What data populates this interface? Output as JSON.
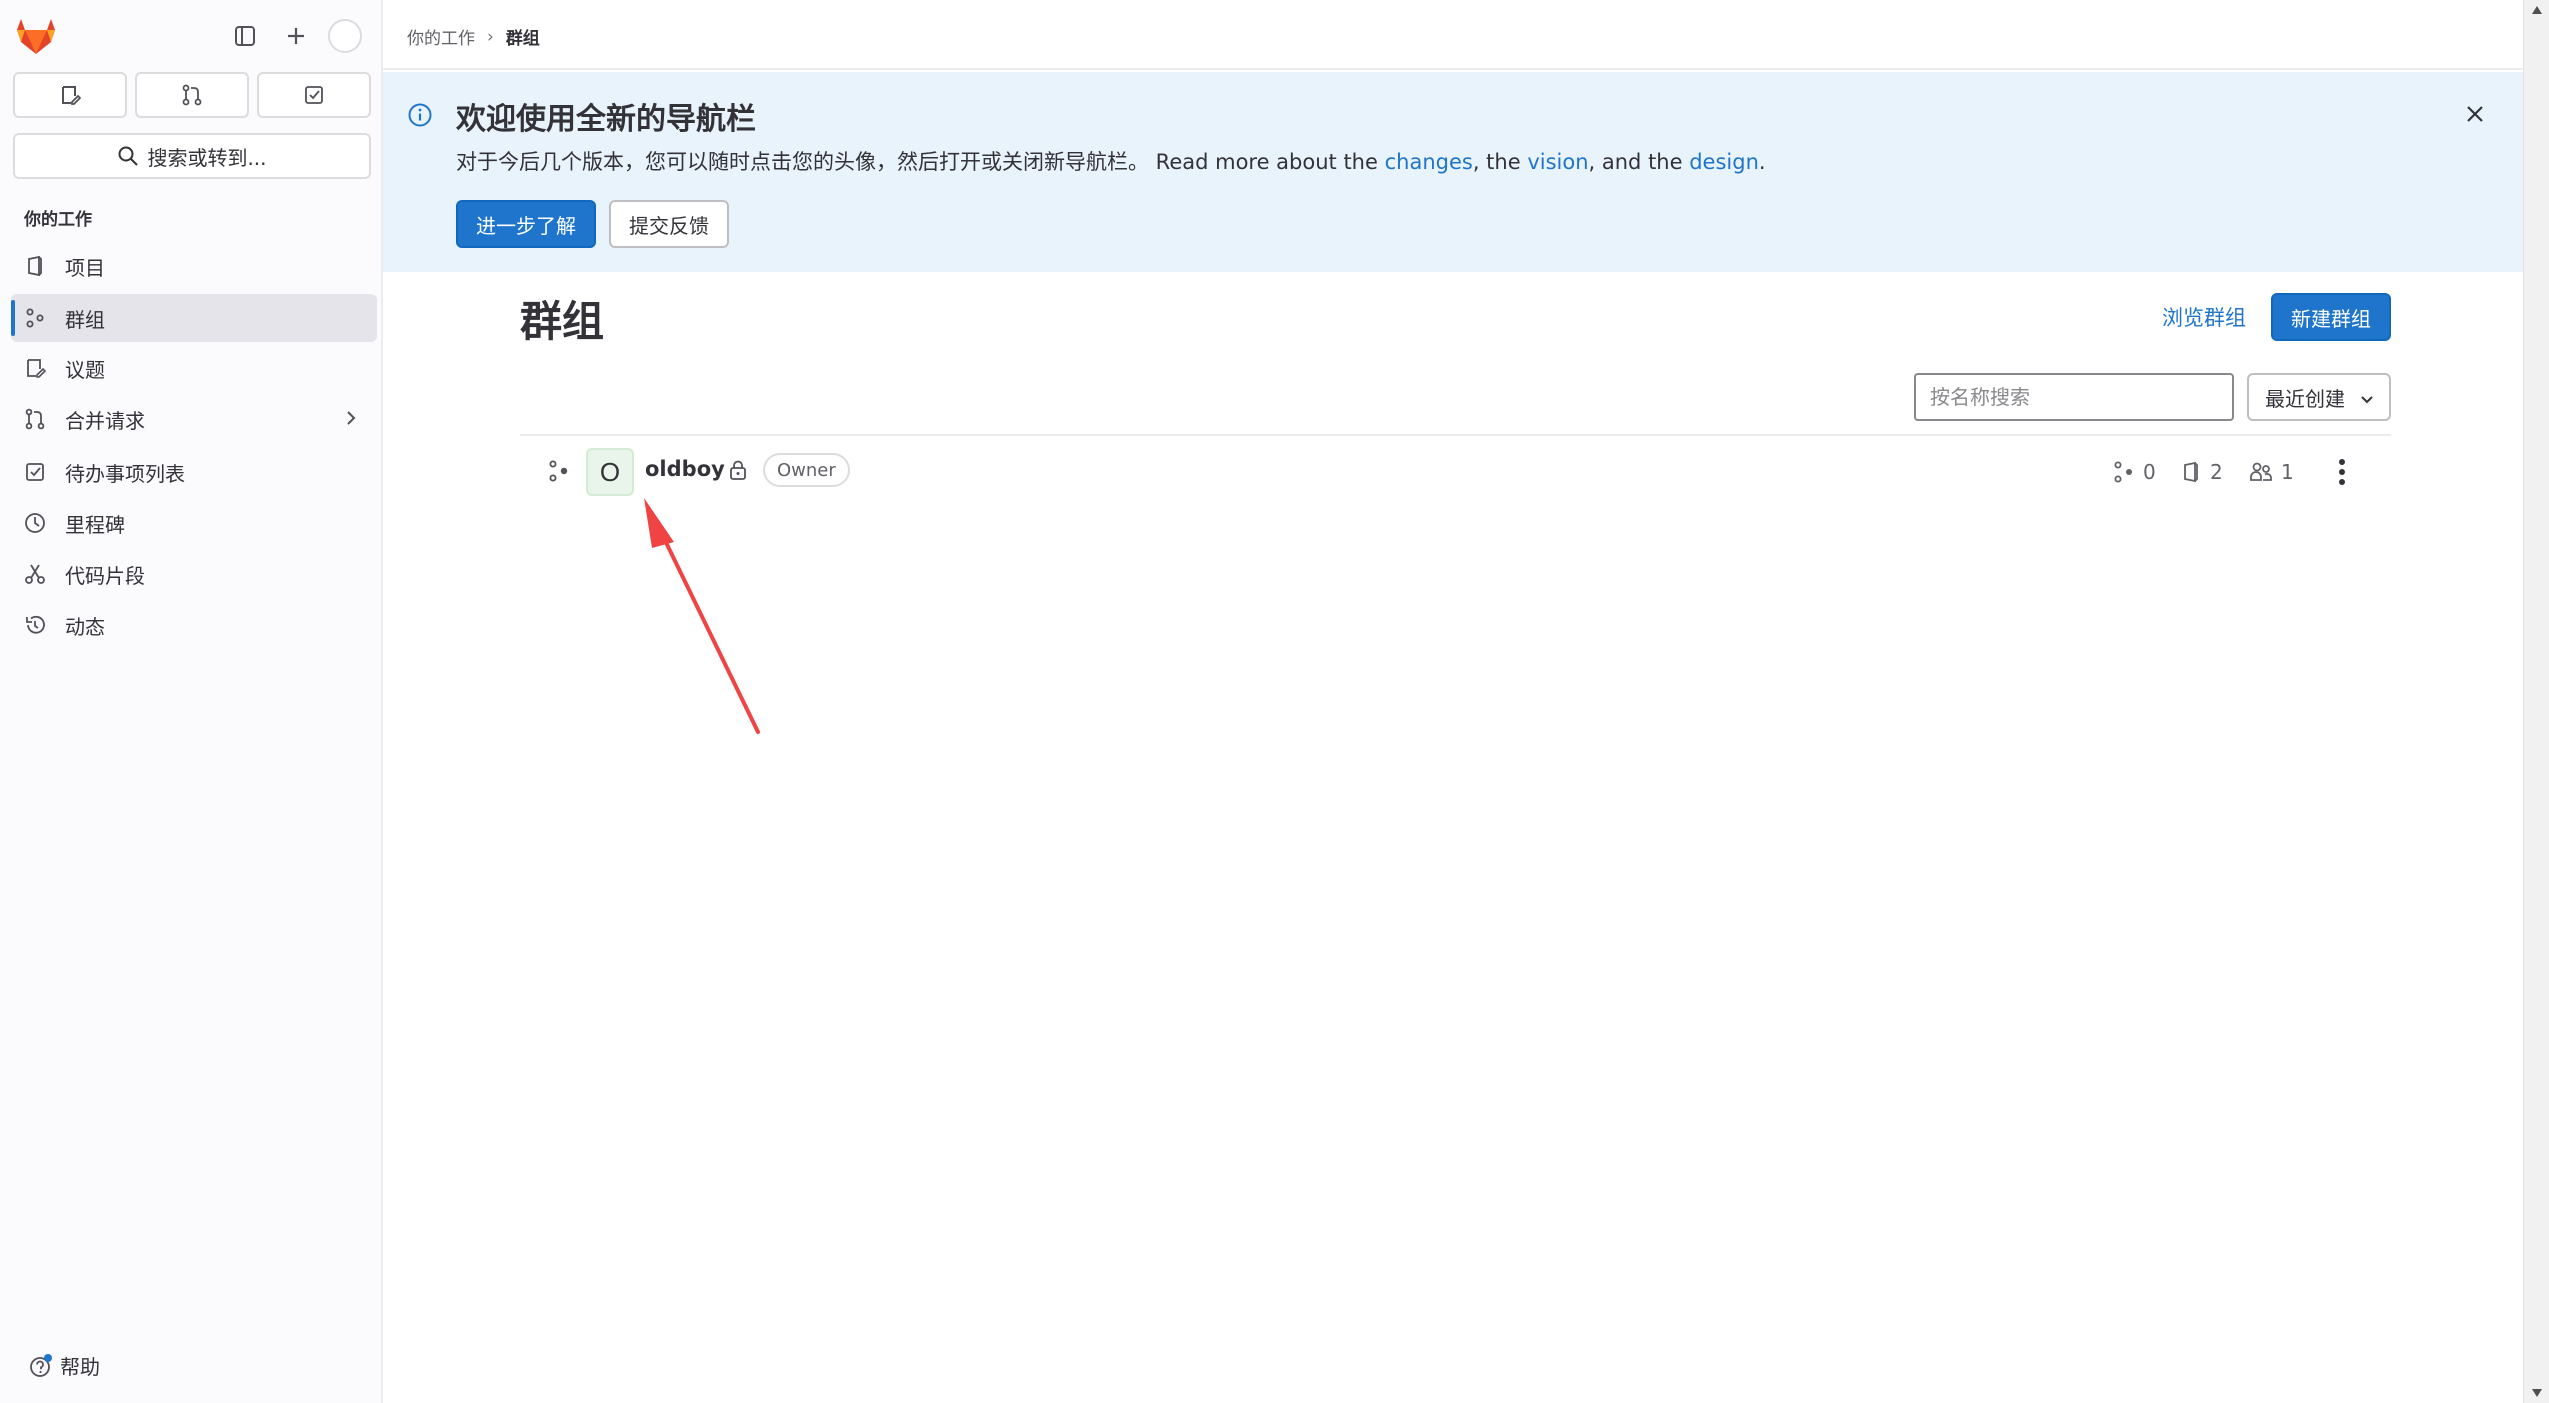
{
  "sidebar": {
    "logo_icon": "gitlab-tanuki-icon",
    "search_label": "搜索或转到...",
    "section_title": "你的工作",
    "items": [
      {
        "label": "项目",
        "icon": "project-icon"
      },
      {
        "label": "群组",
        "icon": "group-icon",
        "active": true
      },
      {
        "label": "议题",
        "icon": "issues-icon"
      },
      {
        "label": "合并请求",
        "icon": "merge-request-icon"
      },
      {
        "label": "待办事项列表",
        "icon": "todo-icon"
      },
      {
        "label": "里程碑",
        "icon": "milestone-icon"
      },
      {
        "label": "代码片段",
        "icon": "snippet-icon"
      },
      {
        "label": "动态",
        "icon": "activity-icon"
      }
    ],
    "help_label": "帮助"
  },
  "breadcrumb": {
    "parent": "你的工作",
    "separator": "›",
    "current": "群组"
  },
  "banner": {
    "title": "欢迎使用全新的导航栏",
    "text_prefix": "对于今后几个版本，您可以随时点击您的头像，然后打开或关闭新导航栏。 Read more about the ",
    "link_changes": "changes",
    "text_mid1": ", the ",
    "link_vision": "vision",
    "text_mid2": ", and the ",
    "link_design": "design",
    "text_end": ".",
    "primary_button": "进一步了解",
    "secondary_button": "提交反馈"
  },
  "main": {
    "title": "群组",
    "browse_link": "浏览群组",
    "new_button": "新建群组",
    "search_placeholder": "按名称搜索",
    "sort_label": "最近创建"
  },
  "groups": [
    {
      "avatar_letter": "O",
      "name": "oldboy",
      "visibility": "private",
      "role": "Owner",
      "subgroups": "0",
      "projects": "2",
      "members": "1"
    }
  ],
  "colors": {
    "accent": "#1f75cb",
    "banner_bg": "#e9f3fc",
    "annotation_arrow": "#f04444"
  }
}
